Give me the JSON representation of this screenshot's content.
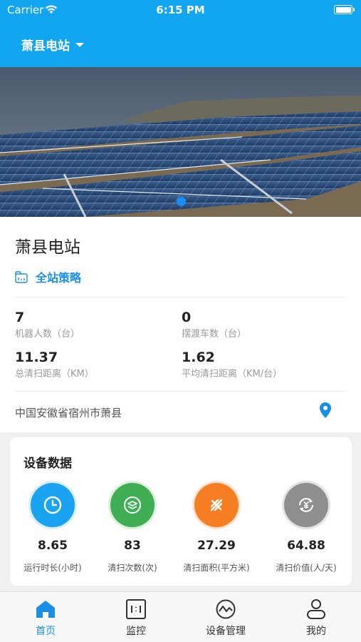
{
  "status_bar": {
    "carrier": "Carrier",
    "time": "6:15 PM"
  },
  "header": {
    "station_name": "萧县电站"
  },
  "banner": {
    "image": "solar-panels-photo"
  },
  "station": {
    "title": "萧县电站",
    "strategy_label": "全站策略",
    "stats": [
      {
        "value": "7",
        "label": "机器人数（台）"
      },
      {
        "value": "0",
        "label": "摆渡车数（台）"
      },
      {
        "value": "11.37",
        "label": "总清扫距离（KM）"
      },
      {
        "value": "1.62",
        "label": "平均清扫距离（KM/台）"
      }
    ],
    "address": "中国安徽省宿州市萧县"
  },
  "equipment": {
    "title": "设备数据",
    "metrics": [
      {
        "value": "8.65",
        "label": "运行时长(小时)",
        "icon": "clock-icon",
        "color": "#1aa3f0"
      },
      {
        "value": "83",
        "label": "清扫次数(次)",
        "icon": "layers-icon",
        "color": "#3fae55"
      },
      {
        "value": "27.29",
        "label": "清扫面积(平方米)",
        "icon": "area-icon",
        "color": "#f57e22"
      },
      {
        "value": "64.88",
        "label": "清扫价值(人/天)",
        "icon": "yuan-icon",
        "color": "#8e8e8e"
      }
    ]
  },
  "tabs": [
    {
      "label": "首页",
      "icon": "home-icon",
      "active": true
    },
    {
      "label": "监控",
      "icon": "monitor-icon",
      "active": false
    },
    {
      "label": "设备管理",
      "icon": "device-management-icon",
      "active": false
    },
    {
      "label": "我的",
      "icon": "profile-icon",
      "active": false
    }
  ],
  "colors": {
    "primary": "#12a5f0",
    "accent": "#1990e6"
  }
}
